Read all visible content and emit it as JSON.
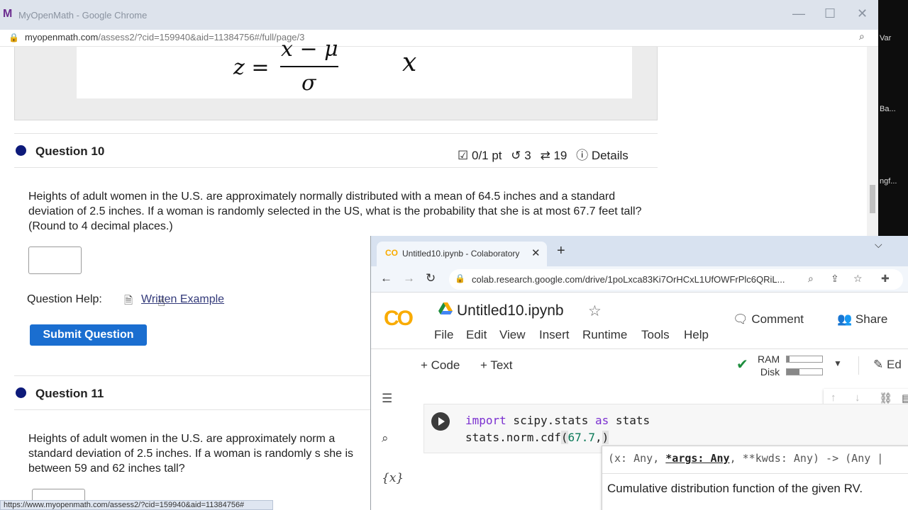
{
  "browser1": {
    "tab_title": "MyOpenMath - Google Chrome",
    "logo": "M",
    "url_host": "myopenmath.com",
    "url_path": "/assess2/?cid=159940&aid=11384756#/full/page/3",
    "status_url": "https://www.myopenmath.com/assess2/?cid=159940&aid=11384756#",
    "minimize": "—",
    "maximize": "☐",
    "close": "✕"
  },
  "desktop_strip": [
    "Var",
    "Ba...",
    "ngf..."
  ],
  "formula": {
    "lhs": "z =",
    "numerator": "x − μ",
    "denominator": "σ",
    "var": "x"
  },
  "question10": {
    "title": "Question 10",
    "score": "0/1 pt",
    "retries": "3",
    "attempts": "19",
    "details": "Details",
    "text": "Heights of adult women in the U.S. are approximately normally distributed with a mean of 64.5 inches and a standard deviation of 2.5 inches. If a woman is randomly selected in the US, what is the probability that she is at most 67.7 feet tall? (Round to 4 decimal places.)",
    "help_label": "Question Help:",
    "help_link": "Written Example",
    "submit": "Submit Question"
  },
  "question11": {
    "title": "Question 11",
    "text": "Heights of adult women in the U.S. are approximately norm a standard deviation of 2.5 inches. If a woman is randomly s she is between 59 and 62 inches tall?"
  },
  "colab": {
    "tab_title": "Untitled10.ipynb - Colaboratory",
    "tab_logo": "CO",
    "new_tab": "+",
    "url": "colab.research.google.com/drive/1poLxca83Ki7OrHCxL1UfOWFrPlc6QRiL...",
    "logo": "CO",
    "notebook_title": "Untitled10.ipynb",
    "menu": [
      "File",
      "Edit",
      "View",
      "Insert",
      "Runtime",
      "Tools",
      "Help"
    ],
    "comment": "Comment",
    "share": "Share",
    "add_code": "+ Code",
    "add_text": "+ Text",
    "ram_label": "RAM",
    "disk_label": "Disk",
    "ram_fill": 0.08,
    "disk_fill": 0.35,
    "edit": "Ed",
    "code_line1": {
      "kw1": "import",
      "mod": " scipy.stats ",
      "kw2": "as",
      "alias": " stats"
    },
    "code_line2": {
      "call": "stats.norm.cdf",
      "open": "(",
      "arg": "67.7",
      "comma": ",",
      "close": ")"
    },
    "tooltip_sig_pre": "(x: Any, ",
    "tooltip_sig_bold": "*args: Any",
    "tooltip_sig_post": ", **kwds: Any) -> (Any |",
    "tooltip_doc": "Cumulative distribution function of the given RV."
  }
}
